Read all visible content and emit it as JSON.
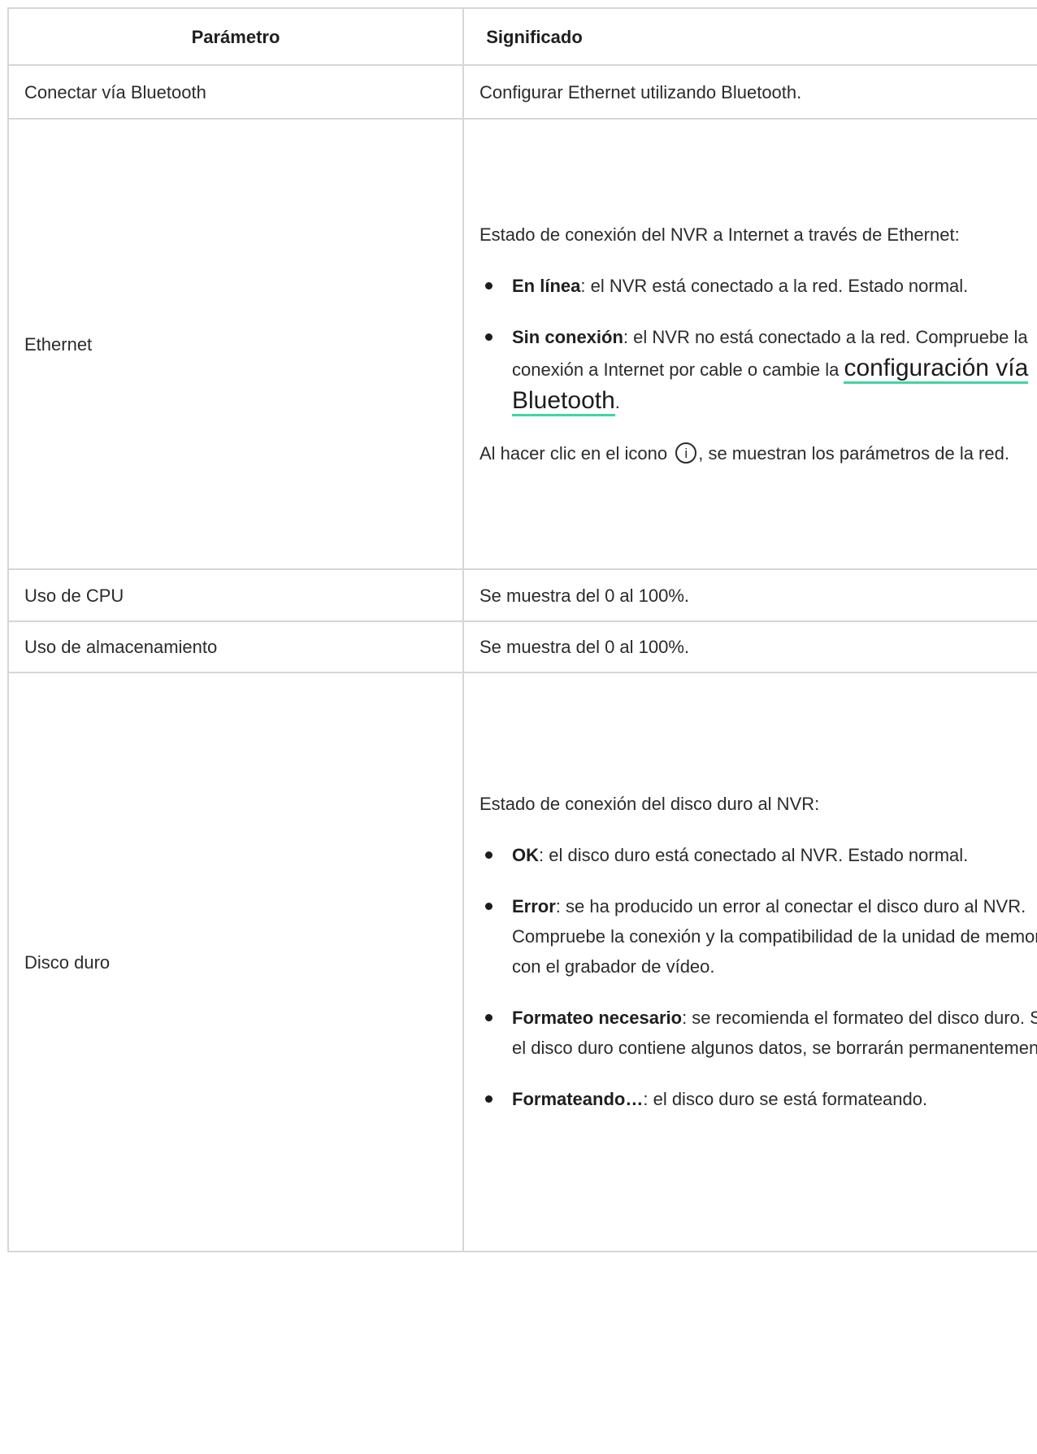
{
  "table": {
    "headers": {
      "parameter": "Parámetro",
      "meaning": "Significado"
    },
    "rows": {
      "bluetooth": {
        "name": "Conectar vía Bluetooth",
        "meaning": "Configurar Ethernet utilizando Bluetooth."
      },
      "ethernet": {
        "name": "Ethernet",
        "intro": "Estado de conexión del NVR a Internet a través de Ethernet:",
        "online_term": "En línea",
        "online_text": ": el NVR está conectado a la red. Estado normal.",
        "offline_term": "Sin conexión",
        "offline_text": ": el NVR no está conectado a la red. Compruebe la conexión a Internet por cable o cambie la ",
        "offline_link": "configuración vía Bluetooth",
        "offline_end": ".",
        "info_before": "Al hacer clic en el icono ",
        "info_icon": "i",
        "info_after": ", se muestran los parámetros de la red."
      },
      "cpu": {
        "name": "Uso de CPU",
        "meaning": "Se muestra del 0 al 100%."
      },
      "storage": {
        "name": "Uso de almacenamiento",
        "meaning": "Se muestra del 0 al 100%."
      },
      "hdd": {
        "name": "Disco duro",
        "intro": "Estado de conexión del disco duro al NVR:",
        "ok_term": "OK",
        "ok_text": ": el disco duro está conectado al NVR. Estado normal.",
        "error_term": "Error",
        "error_text": ": se ha producido un error al conectar el disco duro al NVR. Compruebe la conexión y la compatibilidad de la unidad de memoria con el grabador de vídeo.",
        "format_term": "Formateo necesario",
        "format_text": ": se recomienda el formateo del disco duro. Si el disco duro contiene algunos datos, se borrarán permanentemente.",
        "formatting_term": "Formateando…",
        "formatting_text": ": el disco duro se está formateando."
      }
    }
  }
}
